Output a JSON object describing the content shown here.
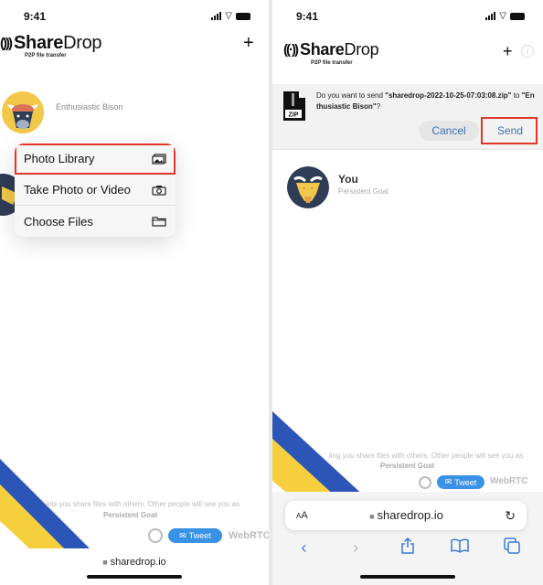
{
  "left": {
    "status": {
      "time": "9:41"
    },
    "header": {
      "logo_bold": "Share",
      "logo_light": "Drop",
      "subtitle": "P2P file transfer",
      "plus": "+"
    },
    "peer": {
      "name": "Enthusiastic Bison"
    },
    "menu": {
      "items": [
        {
          "label": "Photo Library",
          "icon": "photo-library-icon",
          "highlighted": true
        },
        {
          "label": "Take Photo or Video",
          "icon": "camera-icon",
          "highlighted": false
        },
        {
          "label": "Choose Files",
          "icon": "folder-icon",
          "highlighted": false
        }
      ]
    },
    "footer": {
      "text": "lets you share files with others. Other people will see you as",
      "name": "Persistent Goat",
      "tweet": "Tweet",
      "webrtc": "WebRTC"
    },
    "url": "sharedrop.io"
  },
  "right": {
    "status": {
      "time": "9:41"
    },
    "header": {
      "logo_bold": "Share",
      "logo_light": "Drop",
      "subtitle": "P2P file transfer",
      "plus": "+",
      "info": "i"
    },
    "dialog": {
      "prefix": "Do you want to send ",
      "filename": "\"sharedrop-2022-10-25-07:03:08.zip\"",
      "middle": " to ",
      "recipient": "\"Enthusiastic Bison\"",
      "suffix": "?",
      "zip_label": "ZIP",
      "cancel": "Cancel",
      "send": "Send"
    },
    "you": {
      "label": "You",
      "name": "Persistent Goat"
    },
    "footer": {
      "text": "ling you share files with others. Other people will see you as",
      "name": "Persistent Goat",
      "tweet": "Tweet",
      "webrtc": "WebRTC"
    },
    "safari": {
      "aa": "AA",
      "url": "sharedrop.io"
    }
  },
  "colors": {
    "highlight": "#e0362a",
    "link": "#3b6fb0",
    "tweet": "#3a92e6",
    "stripe_blue": "#2b56b8",
    "stripe_yellow": "#f5cf3d"
  }
}
